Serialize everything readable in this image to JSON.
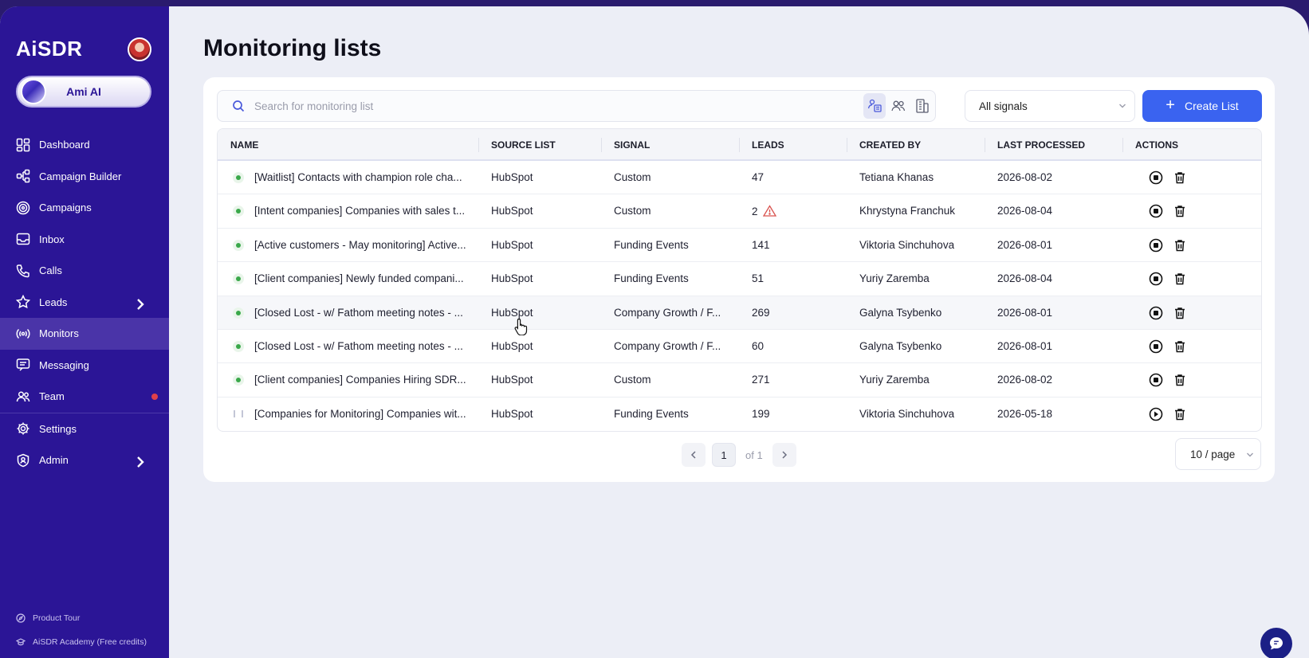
{
  "app": {
    "brand": "AiSDR",
    "assistant_label": "Ami AI"
  },
  "sidebar": {
    "items": [
      {
        "label": "Dashboard",
        "icon": "dashboard-icon"
      },
      {
        "label": "Campaign Builder",
        "icon": "campaign-builder-icon"
      },
      {
        "label": "Campaigns",
        "icon": "campaigns-icon"
      },
      {
        "label": "Inbox",
        "icon": "inbox-icon"
      },
      {
        "label": "Calls",
        "icon": "phone-icon"
      },
      {
        "label": "Leads",
        "icon": "star-icon"
      },
      {
        "label": "Monitors",
        "icon": "broadcast-icon"
      },
      {
        "label": "Messaging",
        "icon": "messaging-icon"
      },
      {
        "label": "Team",
        "icon": "team-icon"
      },
      {
        "label": "Settings",
        "icon": "gear-icon"
      },
      {
        "label": "Admin",
        "icon": "shield-user-icon"
      }
    ],
    "active": "Monitors",
    "footer": {
      "product_tour": "Product Tour",
      "academy": "AiSDR Academy (Free credits)"
    }
  },
  "page": {
    "title": "Monitoring lists"
  },
  "toolbar": {
    "search_placeholder": "Search for monitoring list",
    "signals_filter": "All signals",
    "create_label": "Create List"
  },
  "table": {
    "headers": {
      "name": "NAME",
      "source": "SOURCE LIST",
      "signal": "SIGNAL",
      "leads": "LEADS",
      "created_by": "CREATED BY",
      "last_processed": "LAST PROCESSED",
      "actions": "ACTIONS"
    },
    "rows": [
      {
        "name": "[Waitlist] Contacts with champion role cha...",
        "source": "HubSpot",
        "signal": "Custom",
        "leads": "47",
        "created_by": "Tetiana Khanas",
        "last_processed": "2026-08-02",
        "status": "active"
      },
      {
        "name": "[Intent companies] Companies with sales t...",
        "source": "HubSpot",
        "signal": "Custom",
        "leads": "2",
        "created_by": "Khrystyna Franchuk",
        "last_processed": "2026-08-04",
        "status": "active",
        "warning": true
      },
      {
        "name": "[Active customers - May monitoring] Active...",
        "source": "HubSpot",
        "signal": "Funding Events",
        "leads": "141",
        "created_by": "Viktoria Sinchuhova",
        "last_processed": "2026-08-01",
        "status": "active"
      },
      {
        "name": "[Client companies] Newly funded compani...",
        "source": "HubSpot",
        "signal": "Funding Events",
        "leads": "51",
        "created_by": "Yuriy Zaremba",
        "last_processed": "2026-08-04",
        "status": "active"
      },
      {
        "name": "[Closed Lost - w/ Fathom meeting notes - ...",
        "source": "HubSpot",
        "signal": "Company Growth / F...",
        "leads": "269",
        "created_by": "Galyna Tsybenko",
        "last_processed": "2026-08-01",
        "status": "active"
      },
      {
        "name": "[Closed Lost - w/ Fathom meeting notes - ...",
        "source": "HubSpot",
        "signal": "Company Growth / F...",
        "leads": "60",
        "created_by": "Galyna Tsybenko",
        "last_processed": "2026-08-01",
        "status": "active"
      },
      {
        "name": "[Client companies] Companies Hiring SDR...",
        "source": "HubSpot",
        "signal": "Custom",
        "leads": "271",
        "created_by": "Yuriy Zaremba",
        "last_processed": "2026-08-02",
        "status": "active"
      },
      {
        "name": "[Companies for Monitoring] Companies wit...",
        "source": "HubSpot",
        "signal": "Funding Events",
        "leads": "199",
        "created_by": "Viktoria Sinchuhova",
        "last_processed": "2026-05-18",
        "status": "paused"
      }
    ]
  },
  "pagination": {
    "current_page": "1",
    "of_label": "of 1",
    "per_page": "10 / page"
  },
  "colors": {
    "sidebar_bg": "#2b1596",
    "accent": "#3a63f0",
    "active_status": "#3aa84a"
  }
}
